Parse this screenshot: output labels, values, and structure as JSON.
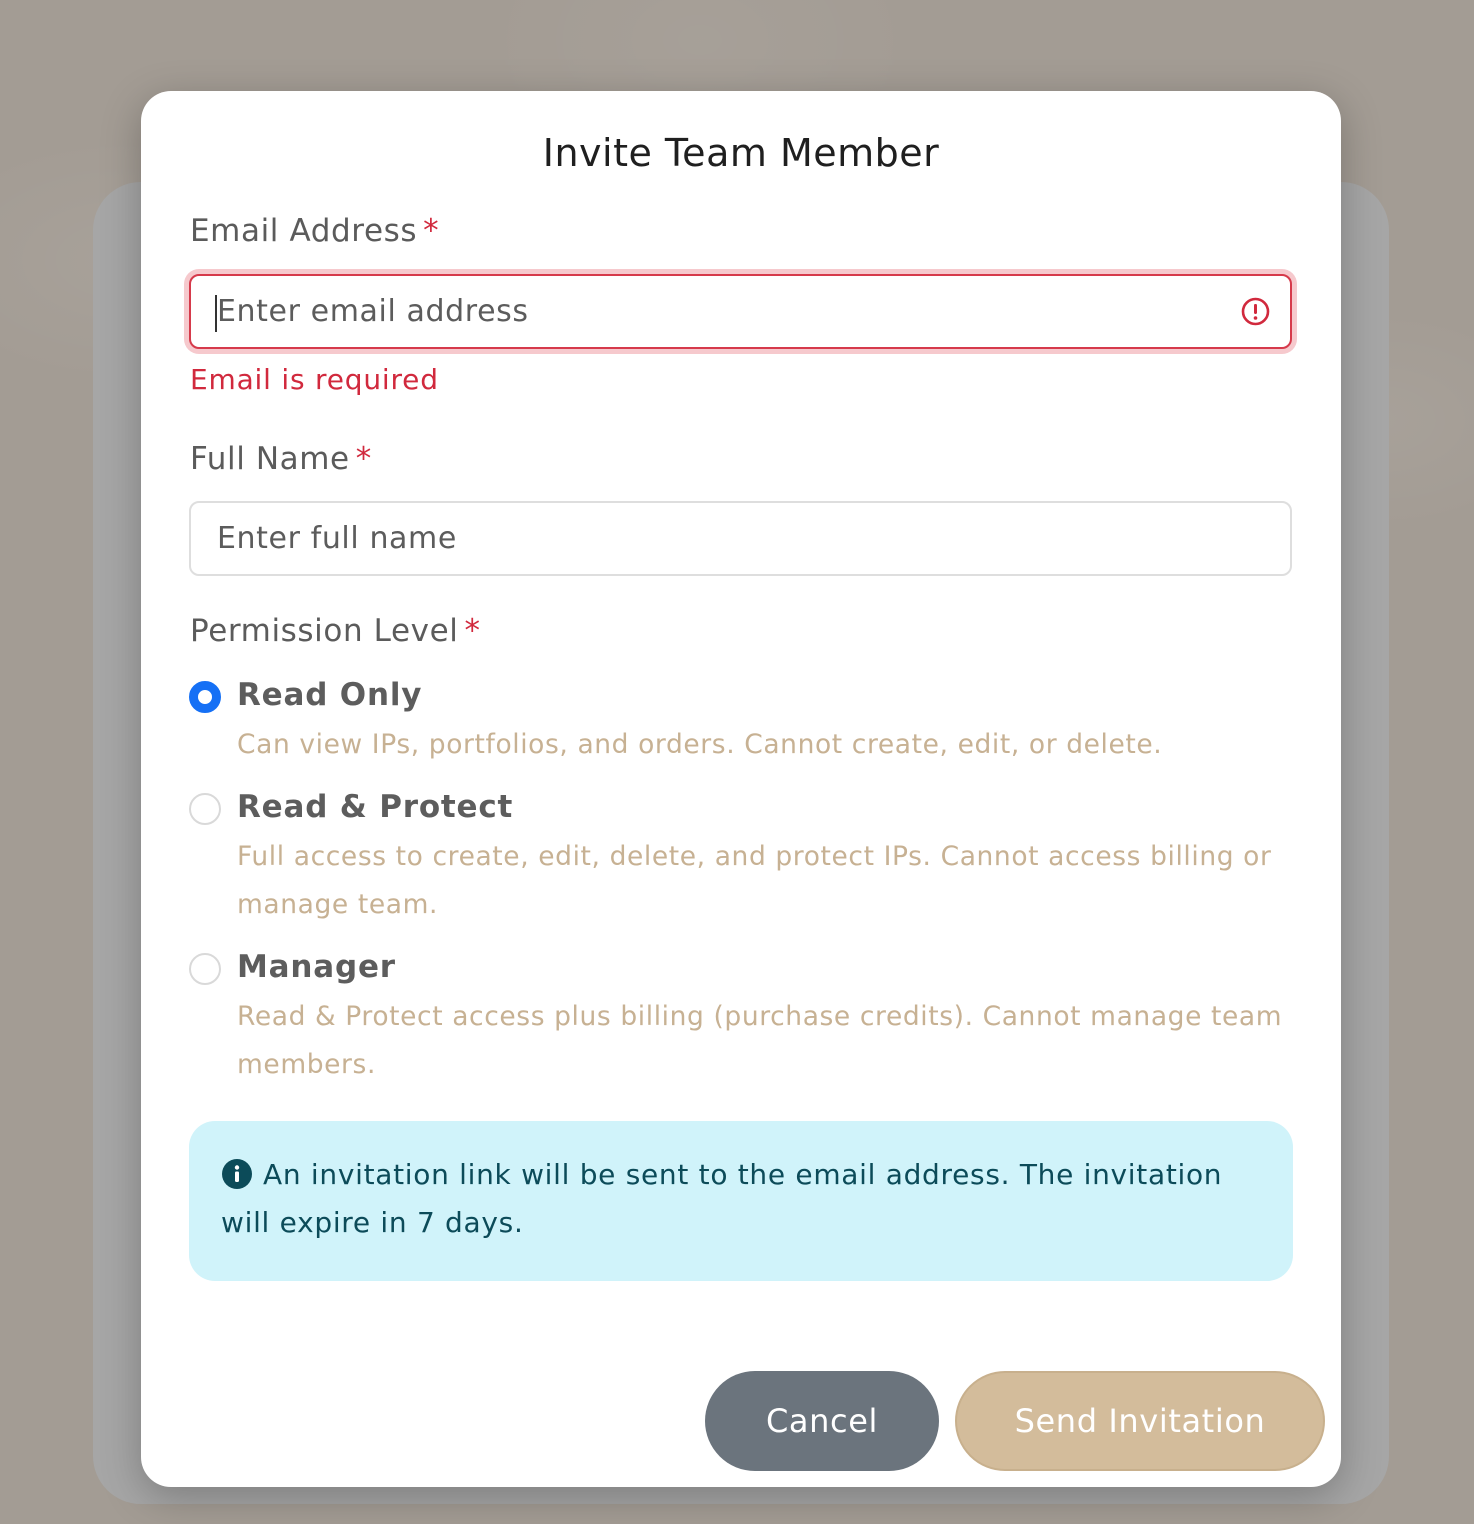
{
  "modal": {
    "title": "Invite Team Member"
  },
  "email": {
    "label": "Email Address",
    "required_mark": "*",
    "placeholder": "Enter email address",
    "value": "",
    "error": "Email is required"
  },
  "full_name": {
    "label": "Full Name",
    "required_mark": "*",
    "placeholder": "Enter full name",
    "value": ""
  },
  "permission": {
    "label": "Permission Level",
    "required_mark": "*",
    "selected": "Read Only",
    "options": [
      {
        "title": "Read Only",
        "description": "Can view IPs, portfolios, and orders. Cannot create, edit, or delete."
      },
      {
        "title": "Read & Protect",
        "description": "Full access to create, edit, delete, and protect IPs. Cannot access billing or manage team."
      },
      {
        "title": "Manager",
        "description": "Read & Protect access plus billing (purchase credits). Cannot manage team members."
      }
    ]
  },
  "info": {
    "icon": "info-icon",
    "text": "An invitation link will be sent to the email address. The invitation will expire in 7 days."
  },
  "buttons": {
    "cancel": "Cancel",
    "send": "Send Invitation"
  },
  "colors": {
    "accent_radio": "#1570f5",
    "error": "#d1293d",
    "primary_button": "#d3bc9b",
    "secondary_button": "#6b747d",
    "info_bg": "#d0f3fa",
    "description_text": "#c7b193"
  }
}
